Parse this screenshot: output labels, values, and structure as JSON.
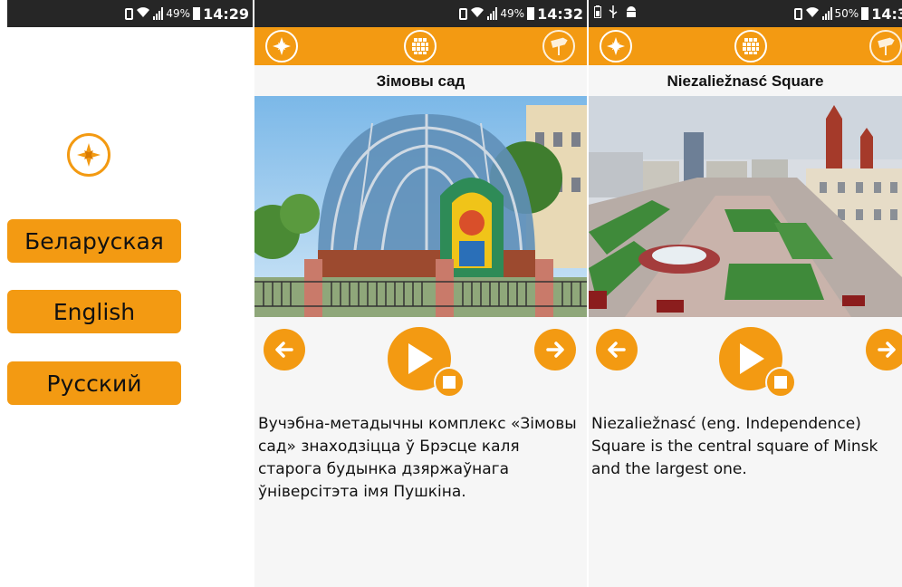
{
  "colors": {
    "accent": "#f39a12",
    "statusbar": "#262626",
    "background": "#f6f6f6"
  },
  "screen1": {
    "status": {
      "battery": "49%",
      "time": "14:29"
    },
    "logo_icon": "compass-rose-icon",
    "languages": [
      "Беларуская",
      "English",
      "Русский"
    ]
  },
  "screen2": {
    "status": {
      "battery": "49%",
      "time": "14:32"
    },
    "toolbar_icons": [
      "compass-rose-icon",
      "grid-icon",
      "signpost-icon"
    ],
    "title": "Зімовы сад",
    "photo_icon": "winter-garden-photo",
    "controls": [
      "arrow-left-icon",
      "play-icon",
      "stop-icon",
      "arrow-right-icon"
    ],
    "description": "Вучэбна-метадычны комплекс «Зімовы сад» знаходзіцца ў Брэсце каля старога будынка дзяржаўнага ўніверсітэта імя Пушкіна."
  },
  "screen3": {
    "status": {
      "battery": "50%",
      "time": "14:3"
    },
    "notification_icons": [
      "battery-icon",
      "usb-icon",
      "android-icon"
    ],
    "toolbar_icons": [
      "compass-rose-icon",
      "grid-icon",
      "signpost-icon"
    ],
    "title": "Niezaliežnasć Square",
    "photo_icon": "square-aerial-photo",
    "controls": [
      "arrow-left-icon",
      "play-icon",
      "stop-icon",
      "arrow-right-icon"
    ],
    "description": "Niezaliežnasć (eng. Independence) Square is the central square of Minsk and the largest one."
  }
}
